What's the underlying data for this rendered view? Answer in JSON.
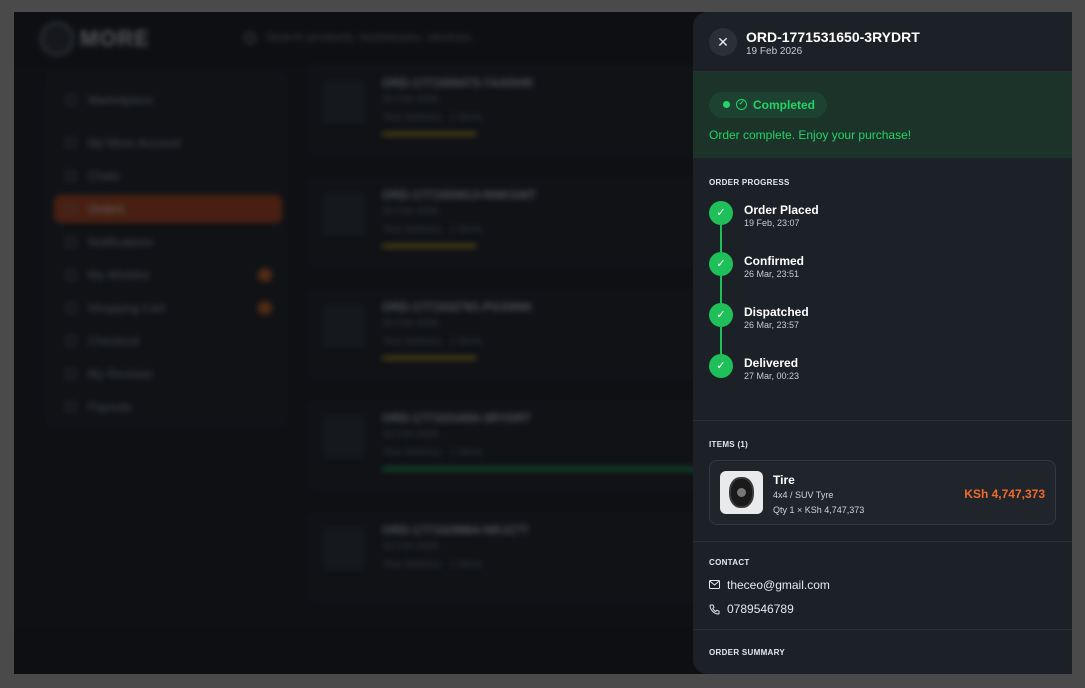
{
  "background": {
    "logo_text": "MORE",
    "search_placeholder": "Search products, businesses, services...",
    "sidebar_items": [
      {
        "label": "Marketplace",
        "active": false,
        "badge": false
      },
      {
        "label": "My More Account",
        "active": false,
        "badge": false
      },
      {
        "label": "Chats",
        "active": false,
        "badge": false
      },
      {
        "label": "Orders",
        "active": true,
        "badge": false
      },
      {
        "label": "Notifications",
        "active": false,
        "badge": false
      },
      {
        "label": "My Wishlist",
        "active": false,
        "badge": true
      },
      {
        "label": "Shopping Cart",
        "active": false,
        "badge": true
      },
      {
        "label": "Checkout",
        "active": false,
        "badge": false
      },
      {
        "label": "My Reviews",
        "active": false,
        "badge": false
      },
      {
        "label": "Payouts",
        "active": false,
        "badge": false
      }
    ],
    "orders": [
      {
        "id": "ORD-1771556473-7AXDHR",
        "date": "20 Feb 2026",
        "meta": "Your Delivery · 1 items",
        "progress": 0.25,
        "color": "#c9a21a"
      },
      {
        "id": "ORD-1771550613-NNKGMT",
        "date": "20 Feb 2026",
        "meta": "Your Delivery · 1 items",
        "progress": 0.25,
        "color": "#c9a21a"
      },
      {
        "id": "ORD-1771532781-PGS9NK",
        "date": "20 Feb 2026",
        "meta": "Your Delivery · 1 items",
        "progress": 0.25,
        "color": "#c9a21a"
      },
      {
        "id": "ORD-1771531650-3RYDRT",
        "date": "19 Feb 2026",
        "meta": "Your Delivery · 1 items",
        "progress": 1.0,
        "color": "#1fbf5a"
      },
      {
        "id": "ORD-1771529884-NRJZ7T",
        "date": "19 Feb 2026",
        "meta": "Your Delivery · 1 items",
        "progress": 0,
        "color": "#1fbf5a"
      }
    ]
  },
  "drawer": {
    "close_icon": "close-icon",
    "order_id": "ORD-1771531650-3RYDRT",
    "order_date": "19 Feb 2026",
    "status": {
      "label": "Completed",
      "message": "Order complete. Enjoy your purchase!",
      "color": "#25d366"
    },
    "progress": {
      "title": "ORDER PROGRESS",
      "steps": [
        {
          "name": "Order Placed",
          "time": "19 Feb, 23:07"
        },
        {
          "name": "Confirmed",
          "time": "26 Mar, 23:51"
        },
        {
          "name": "Dispatched",
          "time": "26 Mar, 23:57"
        },
        {
          "name": "Delivered",
          "time": "27 Mar, 00:23"
        }
      ]
    },
    "items": {
      "title": "ITEMS (1)",
      "list": [
        {
          "name": "Tire",
          "subtitle": "4x4 / SUV Tyre",
          "qty_line": "Qty 1 × KSh 4,747,373",
          "price": "KSh 4,747,373"
        }
      ]
    },
    "contact": {
      "title": "CONTACT",
      "email": "theceo@gmail.com",
      "phone": "0789546789"
    },
    "summary": {
      "title": "ORDER SUMMARY"
    }
  },
  "colors": {
    "accent_orange": "#f06a2a",
    "success_green": "#1fbf5a",
    "panel_bg": "#1c2027"
  }
}
